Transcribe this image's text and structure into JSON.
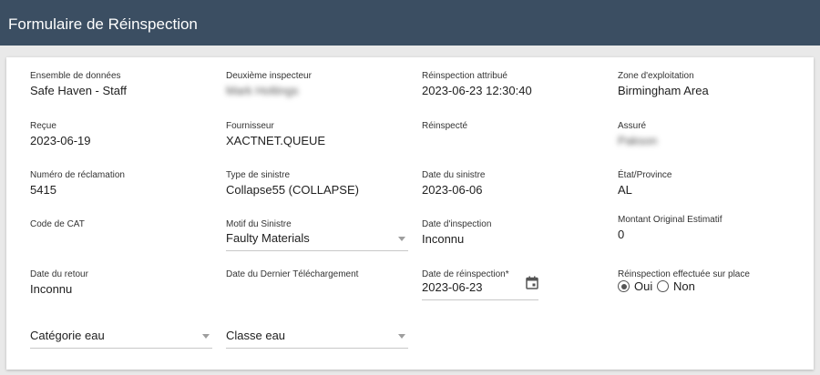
{
  "header": {
    "title": "Formulaire de Réinspection"
  },
  "fields": {
    "dataset": {
      "label": "Ensemble de données",
      "value": "Safe Haven - Staff"
    },
    "second_inspector": {
      "label": "Deuxième inspecteur",
      "value": "Mark Holtings"
    },
    "reinspection_assigned": {
      "label": "Réinspection attribué",
      "value": "2023-06-23 12:30:40"
    },
    "operating_zone": {
      "label": "Zone d'exploitation",
      "value": "Birmingham Area"
    },
    "received": {
      "label": "Reçue",
      "value": "2023-06-19"
    },
    "supplier": {
      "label": "Fournisseur",
      "value": "XACTNET.QUEUE"
    },
    "reinspected": {
      "label": "Réinspecté",
      "value": ""
    },
    "insured": {
      "label": "Assuré",
      "value": "Pakson"
    },
    "claim_number": {
      "label": "Numéro de réclamation",
      "value": "5415"
    },
    "loss_type": {
      "label": "Type de sinistre",
      "value": "Collapse55 (COLLAPSE)"
    },
    "loss_date": {
      "label": "Date du sinistre",
      "value": "2023-06-06"
    },
    "state": {
      "label": "État/Province",
      "value": "AL"
    },
    "cat_code": {
      "label": "Code de CAT",
      "value": ""
    },
    "loss_reason": {
      "label": "Motif du Sinistre",
      "value": "Faulty Materials"
    },
    "inspection_date": {
      "label": "Date d'inspection",
      "value": "Inconnu"
    },
    "original_estimate": {
      "label": "Montant Original Estimatif",
      "value": "0"
    },
    "return_date": {
      "label": "Date du retour",
      "value": "Inconnu"
    },
    "last_download_date": {
      "label": "Date du Dernier Téléchargement",
      "value": ""
    },
    "reinspection_date": {
      "label": "Date de réinspection*",
      "value": "2023-06-23"
    },
    "onsite_reinspection": {
      "label": "Réinspection effectuée sur place",
      "options": [
        {
          "label": "Oui",
          "selected": true
        },
        {
          "label": "Non",
          "selected": false
        }
      ]
    }
  },
  "selects": {
    "water_category": {
      "placeholder": "Catégorie eau"
    },
    "water_class": {
      "placeholder": "Classe eau"
    }
  },
  "icons": {
    "calendar": "calendar-icon",
    "dropdown": "chevron-down-icon"
  },
  "colors": {
    "header_bg": "#3b4e62",
    "page_bg": "#e9e9e9"
  }
}
